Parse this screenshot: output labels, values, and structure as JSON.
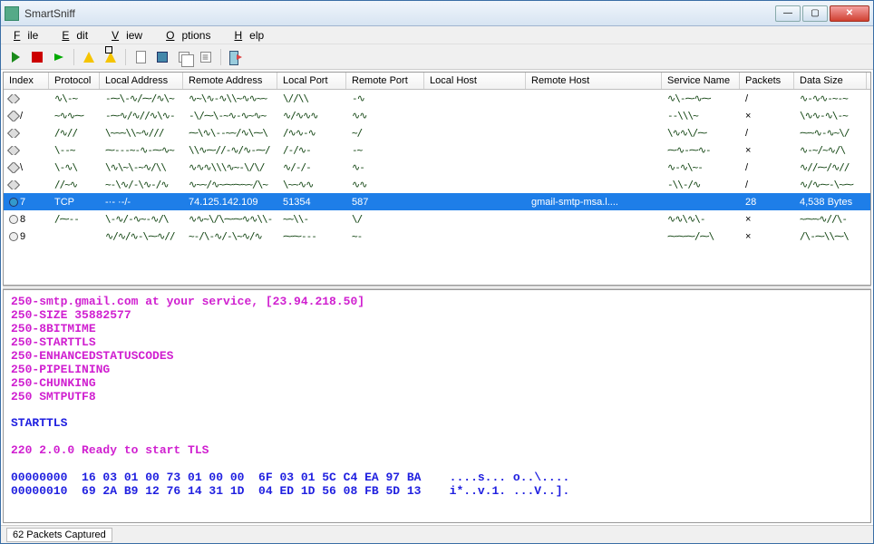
{
  "title": "SmartSniff",
  "menu": {
    "file": "File",
    "edit": "Edit",
    "view": "View",
    "options": "Options",
    "help": "Help"
  },
  "columns": [
    "Index",
    "Protocol",
    "Local Address",
    "Remote Address",
    "Local Port",
    "Remote Port",
    "Local Host",
    "Remote Host",
    "Service Name",
    "Packets",
    "Data Size"
  ],
  "rows": [
    {
      "icon": "diamond",
      "idx": "",
      "proto": "~",
      "laddr": "~",
      "raddr": "~",
      "lport": "~",
      "rport": "~",
      "lhost": "",
      "rhost": "",
      "svc": "~",
      "pkts": "/",
      "dsize": "~",
      "sel": false
    },
    {
      "icon": "diamond",
      "idx": "/",
      "proto": "~",
      "laddr": "~",
      "raddr": "~",
      "lport": "~",
      "rport": "~",
      "lhost": "",
      "rhost": "",
      "svc": "~",
      "pkts": "×",
      "dsize": "~",
      "sel": false
    },
    {
      "icon": "diamond",
      "idx": "",
      "proto": "~",
      "laddr": "~",
      "raddr": "~",
      "lport": "~",
      "rport": "~",
      "lhost": "",
      "rhost": "",
      "svc": "~",
      "pkts": "/",
      "dsize": "~",
      "sel": false
    },
    {
      "icon": "diamond",
      "idx": "",
      "proto": "~",
      "laddr": "~",
      "raddr": "~",
      "lport": "~",
      "rport": "~",
      "lhost": "",
      "rhost": "",
      "svc": "~",
      "pkts": "×",
      "dsize": "~",
      "sel": false
    },
    {
      "icon": "diamond",
      "idx": "\\",
      "proto": "~",
      "laddr": "~",
      "raddr": "~",
      "lport": "~",
      "rport": "~",
      "lhost": "",
      "rhost": "",
      "svc": "~",
      "pkts": "/",
      "dsize": "~",
      "sel": false
    },
    {
      "icon": "diamond",
      "idx": "",
      "proto": "~",
      "laddr": "~",
      "raddr": "~",
      "lport": "~",
      "rport": "~",
      "lhost": "",
      "rhost": "",
      "svc": "~",
      "pkts": "/",
      "dsize": "~",
      "sel": false
    },
    {
      "icon": "circle-blue",
      "idx": "7",
      "proto": "TCP",
      "laddr": "-·- ·-/-",
      "raddr": "74.125.142.109",
      "lport": "51354",
      "rport": "587",
      "lhost": "",
      "rhost": "gmail-smtp-msa.l....",
      "svc": "",
      "pkts": "28",
      "dsize": "4,538 Bytes",
      "sel": true
    },
    {
      "icon": "circle",
      "idx": "8",
      "proto": "~",
      "laddr": "~",
      "raddr": "~",
      "lport": "~",
      "rport": "~",
      "lhost": "",
      "rhost": "",
      "svc": "~",
      "pkts": "×",
      "dsize": "~",
      "sel": false
    },
    {
      "icon": "circle",
      "idx": "9",
      "proto": "",
      "laddr": "~",
      "raddr": "~",
      "lport": "~",
      "rport": "~",
      "lhost": "",
      "rhost": "",
      "svc": "~",
      "pkts": "×",
      "dsize": "~",
      "sel": false
    }
  ],
  "detail_lines": [
    {
      "cls": "ln-magenta",
      "text": "250-smtp.gmail.com at your service, [23.94.218.50]"
    },
    {
      "cls": "ln-magenta",
      "text": "250-SIZE 35882577"
    },
    {
      "cls": "ln-magenta",
      "text": "250-8BITMIME"
    },
    {
      "cls": "ln-magenta",
      "text": "250-STARTTLS"
    },
    {
      "cls": "ln-magenta",
      "text": "250-ENHANCEDSTATUSCODES"
    },
    {
      "cls": "ln-magenta",
      "text": "250-PIPELINING"
    },
    {
      "cls": "ln-magenta",
      "text": "250-CHUNKING"
    },
    {
      "cls": "ln-magenta",
      "text": "250 SMTPUTF8"
    },
    {
      "cls": "",
      "text": ""
    },
    {
      "cls": "ln-blue",
      "text": "STARTTLS"
    },
    {
      "cls": "",
      "text": ""
    },
    {
      "cls": "ln-magenta",
      "text": "220 2.0.0 Ready to start TLS"
    },
    {
      "cls": "",
      "text": ""
    },
    {
      "cls": "ln-blue",
      "text": "00000000  16 03 01 00 73 01 00 00  6F 03 01 5C C4 EA 97 BA    ....s... o..\\...."
    },
    {
      "cls": "ln-blue",
      "text": "00000010  69 2A B9 12 76 14 31 1D  04 ED 1D 56 08 FB 5D 13    i*..v.1. ...V..]."
    }
  ],
  "status": "62 Packets Captured"
}
